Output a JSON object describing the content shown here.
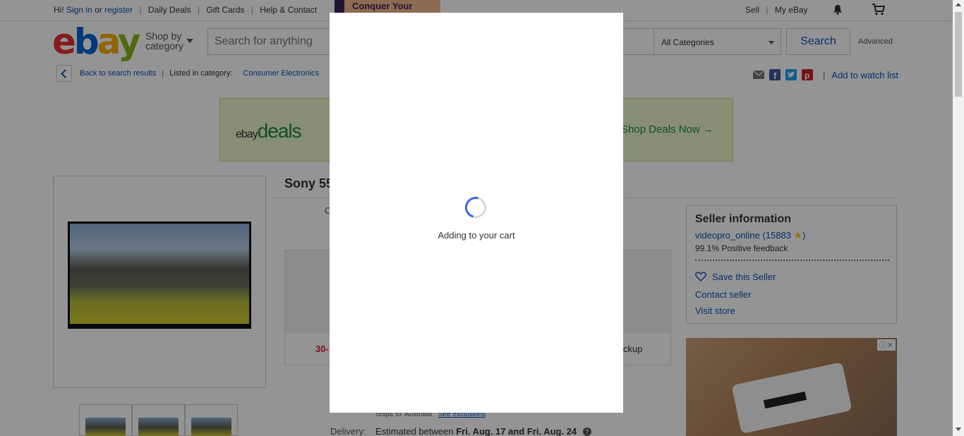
{
  "topbar": {
    "greeting": "Hi!",
    "sign_in": "Sign in",
    "or": "or",
    "register": "register",
    "links": [
      "Daily Deals",
      "Gift Cards",
      "Help & Contact"
    ],
    "promo": "Conquer Your",
    "sell": "Sell",
    "my_ebay": "My eBay",
    "bell_icon": "bell-icon",
    "cart_icon": "cart-icon"
  },
  "header": {
    "logo": "ebay",
    "shop_by_line1": "Shop by",
    "shop_by_line2": "category",
    "search_placeholder": "Search for anything",
    "category": "All Categories",
    "search_button": "Search",
    "advanced": "Advanced"
  },
  "breadcrumb": {
    "back": "Back to search results",
    "listed": "Listed in category:",
    "category": "Consumer Electronics",
    "watch": "Add to watch list"
  },
  "share_icons": [
    "email-icon",
    "facebook-icon",
    "twitter-icon",
    "pinterest-icon"
  ],
  "banner": {
    "brand": "ebay",
    "deals": "deals",
    "cta": "Shop Deals Now →"
  },
  "product": {
    "title": "Sony 55",
    "condition_start": "C",
    "returns": "30-",
    "pickup": "ckup",
    "shipping_label": "S",
    "ships_to_label": "Ships to:",
    "ships_to": "Australia",
    "exclusions": "See exclusions",
    "delivery_label": "Delivery:",
    "delivery_prefix": "Estimated between",
    "delivery_dates": "Fri. Aug. 17 and Fri. Aug. 24",
    "help_icon": "?"
  },
  "seller": {
    "heading": "Seller information",
    "name": "videopro_online",
    "score": "15883",
    "feedback": "99.1% Positive feedback",
    "save": "Save this Seller",
    "contact": "Contact seller",
    "visit": "Visit store"
  },
  "ad": {
    "close": "ⓘ✕"
  },
  "modal": {
    "message": "Adding to your cart"
  },
  "colors": {
    "link": "#0654ba",
    "overlay": "rgba(0,0,0,0.42)",
    "spinner": "#3665f3"
  }
}
